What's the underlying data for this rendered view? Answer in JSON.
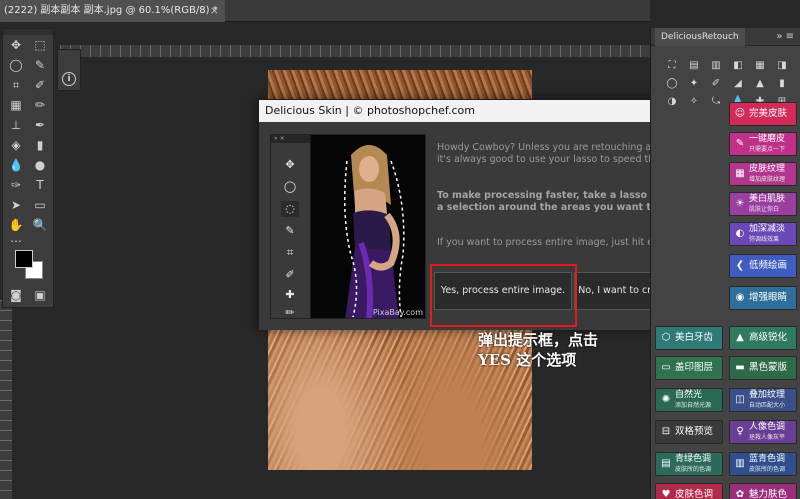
{
  "document_tab": {
    "title": "(2222) 副本副本 副本.jpg @ 60.1%(RGB/8) *",
    "close": "×"
  },
  "dialog": {
    "title": "Delicious Skin | © photoshopchef.com",
    "close": "x",
    "preview_watermark": "PixaBay.com",
    "para1": "Howdy Cowboy? Unless you are retouching a close-up shot, it's always good to use your lasso to speed things up.",
    "para2": "To make processing faster, take a lasso tool and create a selection around the areas you want to retouch.",
    "para3": "If you want to process entire image, just hit enter to continue.",
    "yes_button": "Yes, process entire image.",
    "no_button": "No, I want to create a selection."
  },
  "annotation": {
    "line1": "弹出提示框，点击",
    "line2": "YES 这个选项"
  },
  "right_panel": {
    "tab": "DeliciousRetouch",
    "menu": "»  ≡",
    "buttons": [
      {
        "label": "完美皮肤",
        "sub": "",
        "icon": "face-icon",
        "color": "#d42a5a"
      },
      {
        "label": "一键磨皮",
        "sub": "只需要点一下",
        "icon": "brush-icon",
        "color": "#c0308a"
      },
      {
        "label": "皮肤纹理",
        "sub": "增加皮肤纹理",
        "icon": "texture-icon",
        "color": "#b3368e"
      },
      {
        "label": "美白肌肤",
        "sub": "肌肤让你白",
        "icon": "bulb-icon",
        "color": "#9a3ea0"
      },
      {
        "label": "加深减淡",
        "sub": "弥调线效果",
        "icon": "dodge-icon",
        "color": "#6a48b8"
      },
      {
        "label": "低频绘画",
        "sub": "",
        "icon": "chevron-icon",
        "color": "#3e5cc2"
      },
      {
        "label": "增强眼睛",
        "sub": "",
        "icon": "eye-icon",
        "color": "#2d6e9a"
      },
      {
        "label": "美白牙齿",
        "sub": "",
        "icon": "tooth-icon",
        "color": "#2e7a78"
      },
      {
        "label": "高级锐化",
        "sub": "",
        "icon": "triangle-icon",
        "color": "#2f7a5e"
      },
      {
        "label": "盖印图层",
        "sub": "",
        "icon": "layer-icon",
        "color": "#2f7250"
      },
      {
        "label": "黑色蒙版",
        "sub": "",
        "icon": "mask-icon",
        "color": "#2f6a48"
      },
      {
        "label": "自然光",
        "sub": "添加自然光源",
        "icon": "sun-icon",
        "color": "#2a6a52"
      },
      {
        "label": "叠加纹理",
        "sub": "自动匹配大小",
        "icon": "overlay-icon",
        "color": "#3a4e8a"
      },
      {
        "label": "双格预览",
        "sub": "",
        "icon": "compare-icon",
        "color": "#3a3a3a"
      },
      {
        "label": "人像色调",
        "sub": "拯救人像灰平",
        "icon": "portrait-icon",
        "color": "#6a3e96"
      },
      {
        "label": "青绿色调",
        "sub": "皮肤所的色调",
        "icon": "teal-icon",
        "color": "#2d6a5e"
      },
      {
        "label": "蓝青色调",
        "sub": "皮肤所的色调",
        "icon": "blue-icon",
        "color": "#2e4e8e"
      },
      {
        "label": "皮肤色调",
        "sub": "",
        "icon": "skin-icon",
        "color": "#b02a4a"
      },
      {
        "label": "魅力肤色",
        "sub": "",
        "icon": "charm-icon",
        "color": "#9a2e7a"
      }
    ]
  },
  "colors": {
    "highlight": "#e01c1c",
    "dialog_close": "#d8332b",
    "annotation_text": "#ffffff"
  }
}
